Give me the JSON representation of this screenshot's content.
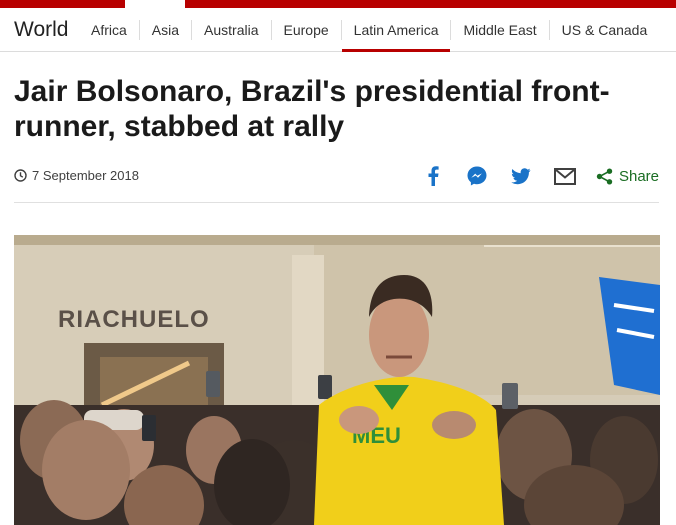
{
  "nav": {
    "brand": "World",
    "items": [
      {
        "label": "Africa"
      },
      {
        "label": "Asia"
      },
      {
        "label": "Australia"
      },
      {
        "label": "Europe"
      },
      {
        "label": "Latin America",
        "active": true
      },
      {
        "label": "Middle East"
      },
      {
        "label": "US & Canada"
      }
    ]
  },
  "article": {
    "headline": "Jair Bolsonaro, Brazil's presidential front-runner, stabbed at rally",
    "date": "7 September 2018"
  },
  "share": {
    "icons": [
      "facebook-icon",
      "messenger-icon",
      "twitter-icon",
      "email-icon"
    ],
    "share_label": "Share"
  },
  "photo": {
    "storefront_sign": "RIACHUELO",
    "shirt_text": "MEU"
  },
  "colors": {
    "brand_red": "#b80000",
    "share_green": "#1a6d23",
    "social_blue": "#1a73c8"
  }
}
